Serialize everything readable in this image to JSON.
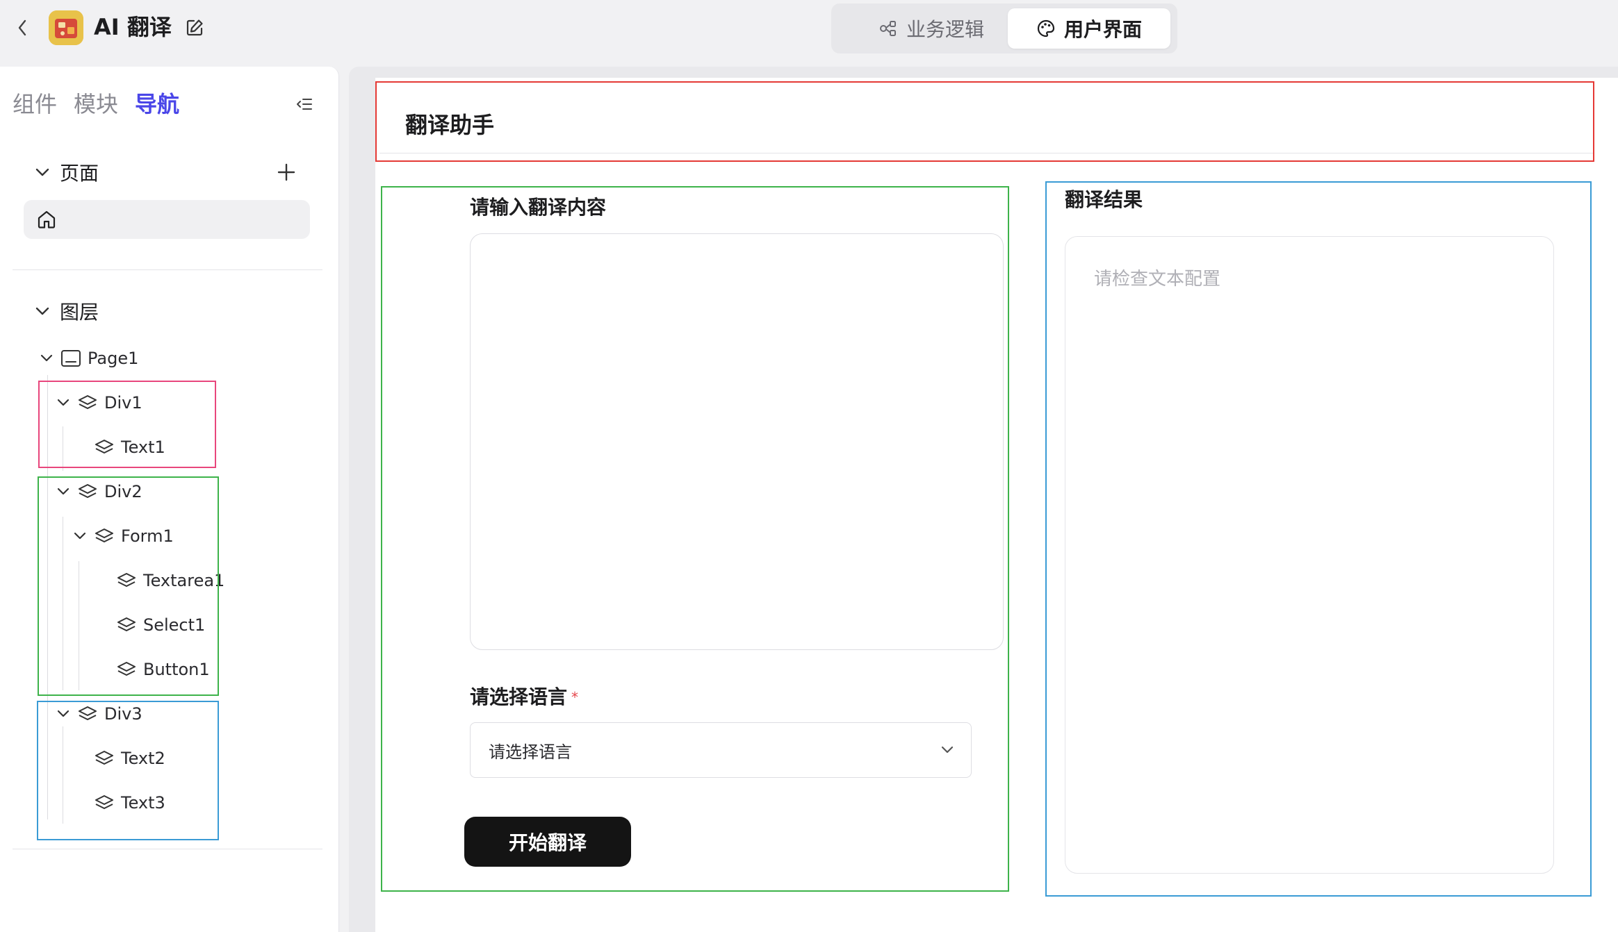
{
  "header": {
    "app_title": "AI 翻译",
    "modes": {
      "logic": "业务逻辑",
      "ui": "用户界面"
    },
    "active_mode": "ui"
  },
  "left_panel": {
    "tabs": [
      "组件",
      "模块",
      "导航"
    ],
    "active_tab": "导航",
    "pages_section": {
      "title": "页面"
    },
    "layers_section": {
      "title": "图层"
    },
    "layers": {
      "page1": "Page1",
      "div1": "Div1",
      "text1": "Text1",
      "div2": "Div2",
      "form1": "Form1",
      "textarea1": "Textarea1",
      "select1": "Select1",
      "button1": "Button1",
      "div3": "Div3",
      "text2": "Text2",
      "text3": "Text3"
    }
  },
  "canvas": {
    "header_text": "翻译助手",
    "form": {
      "textarea_label": "请输入翻译内容",
      "textarea_value": "",
      "select_label": "请选择语言",
      "select_required_mark": "*",
      "select_value": "请选择语言",
      "button_label": "开始翻译"
    },
    "result": {
      "title": "翻译结果",
      "placeholder": "请检查文本配置"
    }
  },
  "colors": {
    "accent": "#4a46e8",
    "highlight_div1_tree": "#e8467c",
    "highlight_div2": "#3db34a",
    "highlight_div3": "#3a9bd5",
    "highlight_header": "#e53935",
    "required": "#e5484d"
  }
}
